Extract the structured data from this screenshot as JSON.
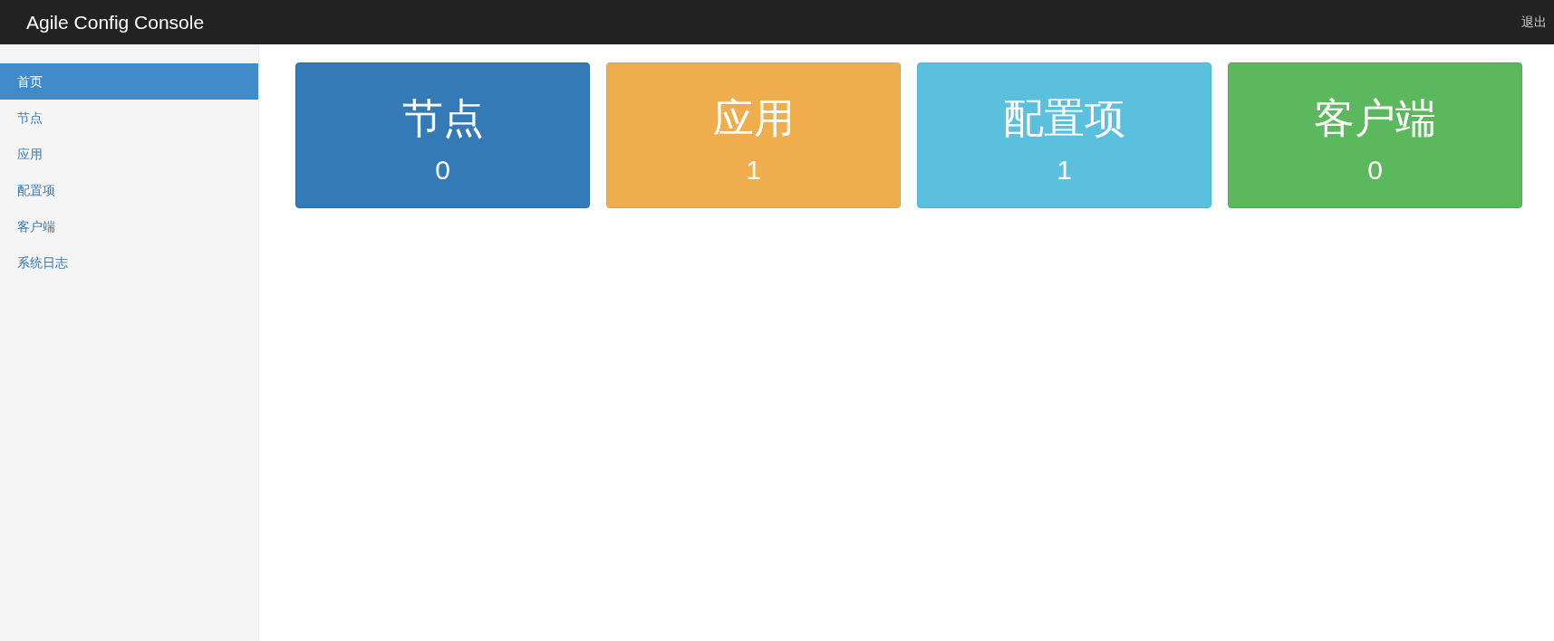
{
  "navbar": {
    "brand": "Agile Config Console",
    "logout": "退出"
  },
  "sidebar": {
    "items": [
      {
        "label": "首页",
        "selected": true
      },
      {
        "label": "节点",
        "selected": false
      },
      {
        "label": "应用",
        "selected": false
      },
      {
        "label": "配置项",
        "selected": false
      },
      {
        "label": "客户端",
        "selected": false
      },
      {
        "label": "系统日志",
        "selected": false
      }
    ]
  },
  "cards": [
    {
      "title": "节点",
      "count": "0",
      "color": "#337ab7"
    },
    {
      "title": "应用",
      "count": "1",
      "color": "#f0ad4e"
    },
    {
      "title": "配置项",
      "count": "1",
      "color": "#5bc0de"
    },
    {
      "title": "客户端",
      "count": "0",
      "color": "#5cb85c"
    }
  ]
}
